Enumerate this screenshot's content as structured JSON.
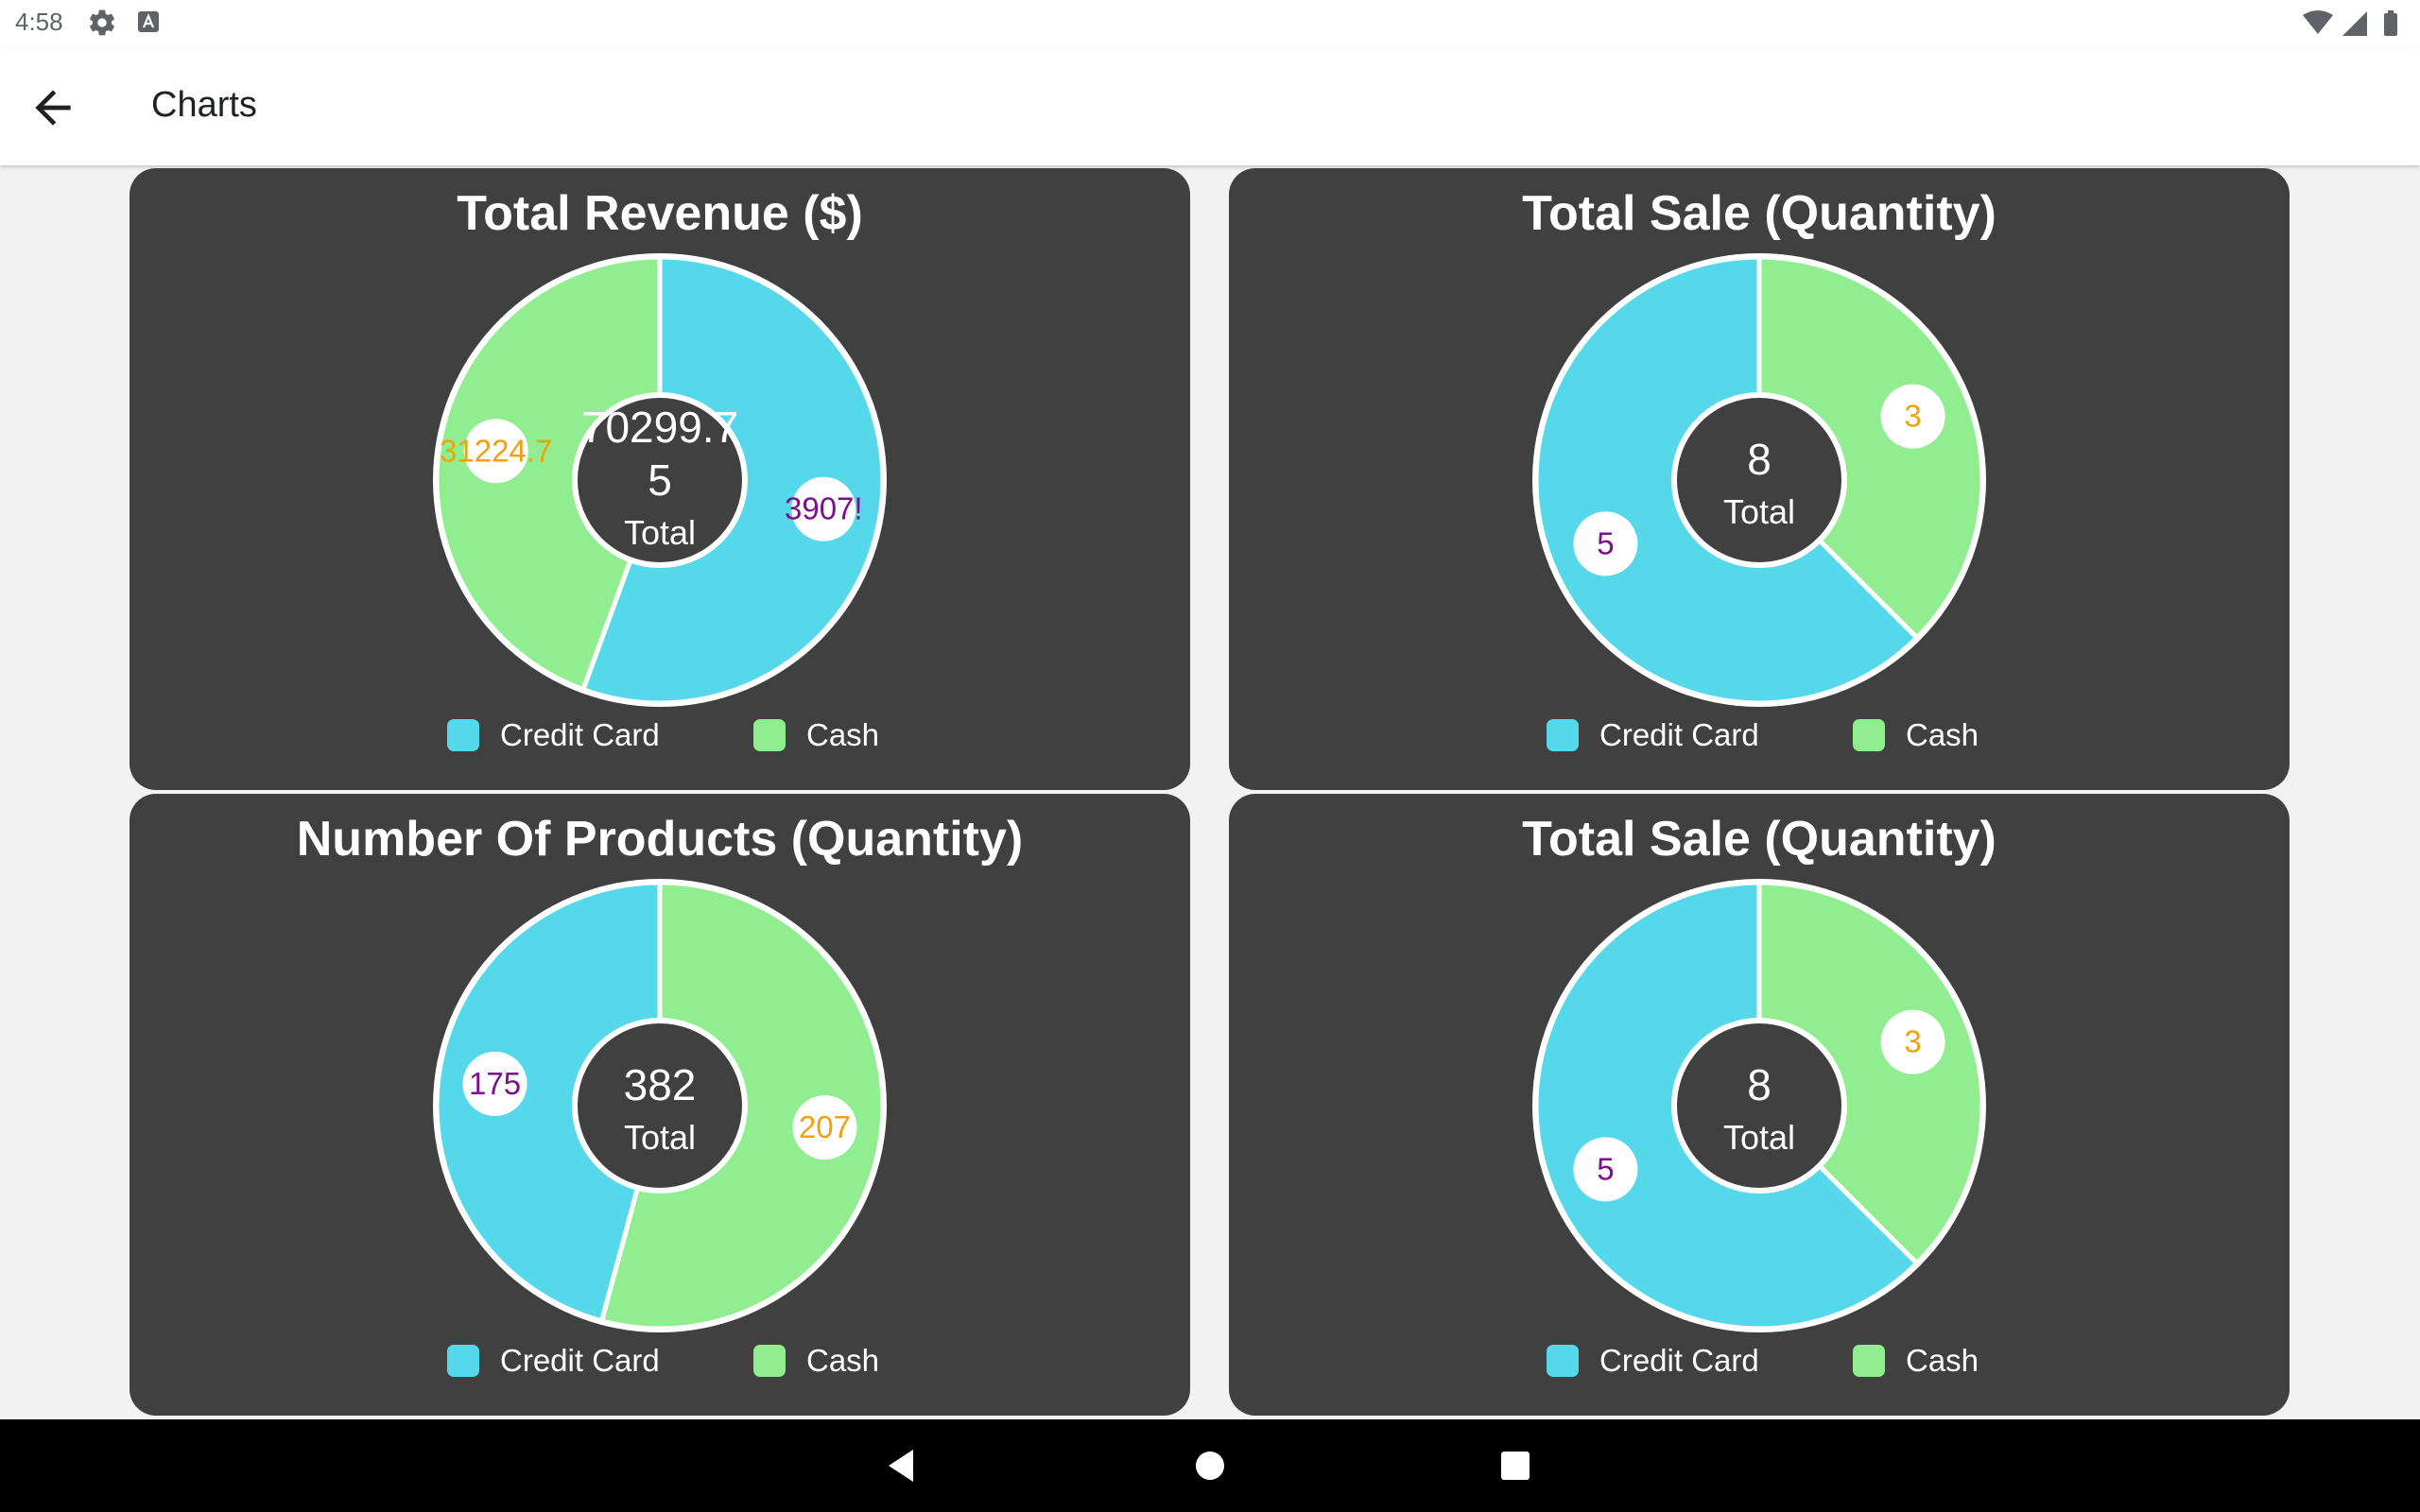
{
  "status_bar": {
    "time": "4:58",
    "icons": [
      "gear-icon",
      "a-box-icon",
      "wifi-icon",
      "signal-icon",
      "battery-icon"
    ]
  },
  "app_bar": {
    "title": "Charts",
    "back_icon": "arrow-back-icon"
  },
  "colors": {
    "credit_card": "#55d9ea",
    "cash": "#90ee90",
    "card_bg": "#404040",
    "inner_label_credit": "#7b0f8e",
    "inner_label_cash": "#f0a10b"
  },
  "chart_data": [
    {
      "type": "pie",
      "title": "Total Revenue ($)",
      "center_value": "70299.75",
      "center_value_lines": [
        "70299.7",
        "5"
      ],
      "center_label": "Total",
      "categories": [
        "Credit Card",
        "Cash"
      ],
      "values": [
        39075,
        31224.75
      ],
      "value_labels": [
        "3907!",
        "31224.7"
      ],
      "legend": [
        "Credit Card",
        "Cash"
      ]
    },
    {
      "type": "pie",
      "title": "Total Sale (Quantity)",
      "center_value": "8",
      "center_label": "Total",
      "categories": [
        "Credit Card",
        "Cash"
      ],
      "values": [
        5,
        3
      ],
      "value_labels": [
        "5",
        "3"
      ],
      "legend": [
        "Credit Card",
        "Cash"
      ]
    },
    {
      "type": "pie",
      "title": "Number Of Products (Quantity)",
      "center_value": "382",
      "center_label": "Total",
      "categories": [
        "Credit Card",
        "Cash"
      ],
      "values": [
        175,
        207
      ],
      "value_labels": [
        "175",
        "207"
      ],
      "legend": [
        "Credit Card",
        "Cash"
      ]
    },
    {
      "type": "pie",
      "title": "Total Sale (Quantity)",
      "center_value": "8",
      "center_label": "Total",
      "categories": [
        "Credit Card",
        "Cash"
      ],
      "values": [
        5,
        3
      ],
      "value_labels": [
        "5",
        "3"
      ],
      "legend": [
        "Credit Card",
        "Cash"
      ]
    }
  ],
  "nav_bar": {
    "icons": [
      "back-triangle-icon",
      "home-circle-icon",
      "recents-square-icon"
    ]
  }
}
